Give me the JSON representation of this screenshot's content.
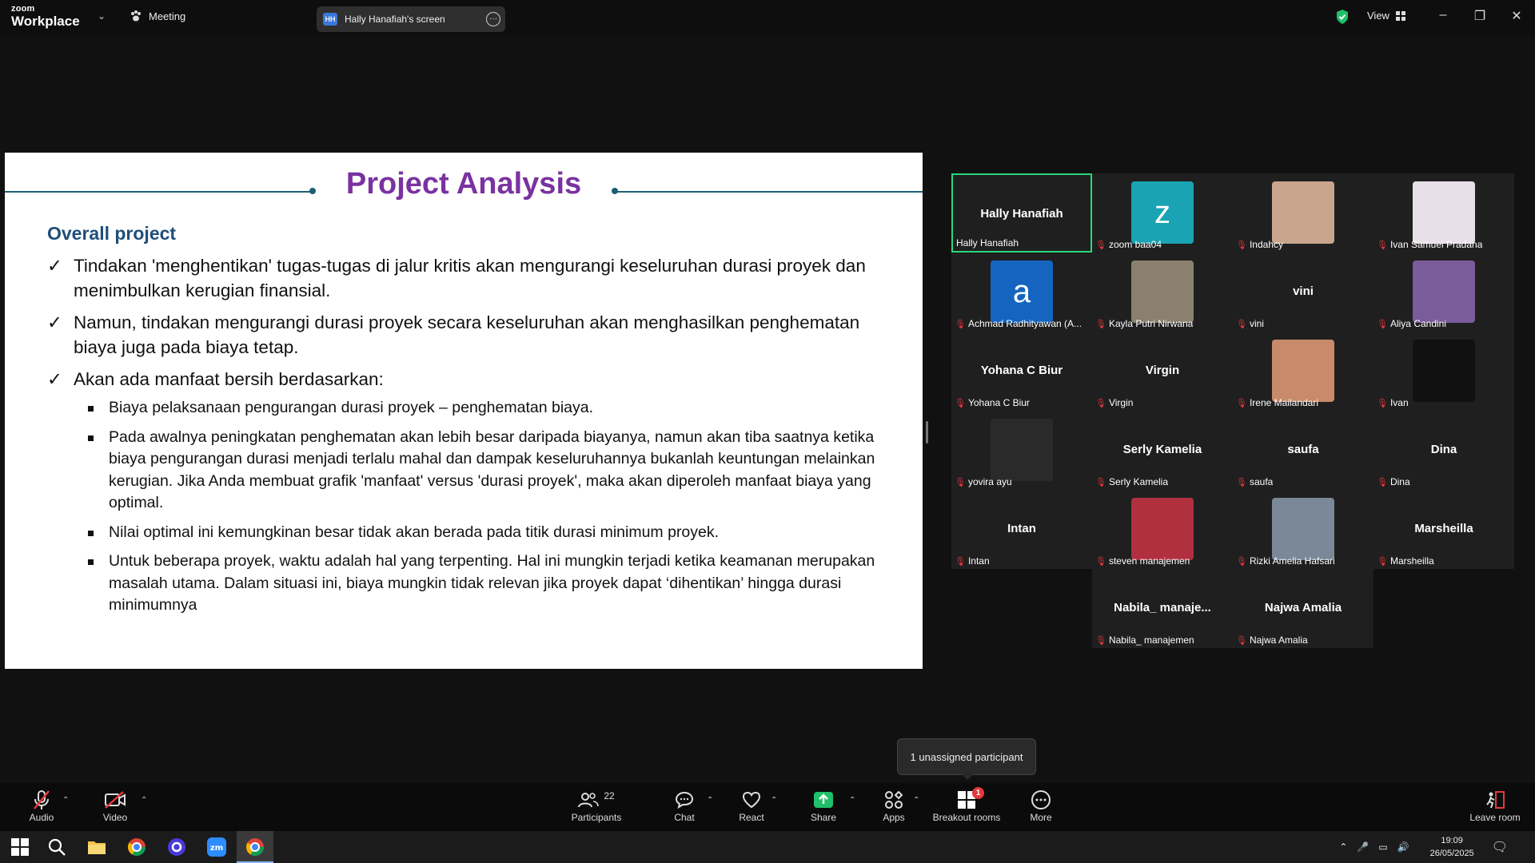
{
  "app": {
    "logo_line1": "zoom",
    "logo_line2": "Workplace",
    "meeting_label": "Meeting",
    "screen_tab_initials": "HH",
    "screen_tab_label": "Hally Hanafiah's screen",
    "view_label": "View"
  },
  "slide": {
    "title": "Project Analysis",
    "subtitle": "Overall project",
    "bullets": [
      "Tindakan 'menghentikan' tugas-tugas di jalur kritis akan mengurangi keseluruhan durasi proyek dan menimbulkan kerugian finansial.",
      "Namun, tindakan mengurangi durasi proyek secara keseluruhan akan menghasilkan penghematan biaya juga pada biaya tetap.",
      "Akan ada manfaat bersih berdasarkan:"
    ],
    "sub_bullets": [
      "Biaya pelaksanaan pengurangan durasi proyek – penghematan biaya.",
      "Pada awalnya peningkatan penghematan akan lebih besar daripada biayanya, namun akan tiba saatnya ketika biaya pengurangan durasi menjadi terlalu mahal dan dampak keseluruhannya bukanlah keuntungan melainkan kerugian. Jika Anda membuat grafik 'manfaat' versus 'durasi proyek', maka akan diperoleh manfaat biaya yang optimal.",
      "Nilai optimal ini kemungkinan besar tidak akan berada pada titik durasi minimum proyek.",
      "Untuk beberapa proyek, waktu adalah hal yang terpenting. Hal ini mungkin terjadi ketika keamanan merupakan masalah utama. Dalam situasi ini, biaya mungkin tidak relevan jika proyek dapat ‘dihentikan’ hingga durasi minimumnya"
    ]
  },
  "participants": [
    {
      "name": "Hally Hanafiah",
      "label": "Hally Hanafiah",
      "tile_text": "Hally Hanafiah",
      "muted": false,
      "active": true
    },
    {
      "name": "zoom baa04",
      "label": "zoom baa04",
      "avatar_letter": "z",
      "avatar_color": "#1aa3b3",
      "muted": true
    },
    {
      "name": "Indahcy",
      "label": "Indahcy",
      "photo": true,
      "muted": true
    },
    {
      "name": "Ivan Samuel Pradana",
      "label": "Ivan Samuel Pradana",
      "photo": true,
      "muted": true
    },
    {
      "name": "Achmad Radhityawan",
      "label": "Achmad Radhityawan (A...",
      "avatar_letter": "a",
      "avatar_color": "#1565c0",
      "muted": true
    },
    {
      "name": "Kayla Putri Nirwana",
      "label": "Kayla Putri Nirwana",
      "photo": true,
      "muted": true
    },
    {
      "name": "vini",
      "label": "vini",
      "tile_text": "vini",
      "muted": true
    },
    {
      "name": "Aliya Candini",
      "label": "Aliya Candini",
      "photo": true,
      "muted": true
    },
    {
      "name": "Yohana C Biur",
      "label": "Yohana C Biur",
      "tile_text": "Yohana C Biur",
      "muted": true
    },
    {
      "name": "Virgin",
      "label": "Virgin",
      "tile_text": "Virgin",
      "muted": true
    },
    {
      "name": "Irene Mailandari",
      "label": "Irene Mailandari",
      "photo": true,
      "muted": true
    },
    {
      "name": "Ivan",
      "label": "Ivan",
      "photo": true,
      "muted": true
    },
    {
      "name": "yovira ayu",
      "label": "yovira ayu",
      "photo": true,
      "muted": true
    },
    {
      "name": "Serly Kamelia",
      "label": "Serly Kamelia",
      "tile_text": "Serly Kamelia",
      "muted": true
    },
    {
      "name": "saufa",
      "label": "saufa",
      "tile_text": "saufa",
      "muted": true
    },
    {
      "name": "Dina",
      "label": "Dina",
      "tile_text": "Dina",
      "muted": true
    },
    {
      "name": "Intan",
      "label": "Intan",
      "tile_text": "Intan",
      "muted": true
    },
    {
      "name": "steven manajemen",
      "label": "steven manajemen",
      "photo": true,
      "muted": true
    },
    {
      "name": "Rizki Amelia Hafsari",
      "label": "Rizki Amelia Hafsari",
      "photo": true,
      "muted": true
    },
    {
      "name": "Marsheilla",
      "label": "Marsheilla",
      "tile_text": "Marsheilla",
      "muted": true
    },
    {
      "name": "Nabila_ manajemen",
      "label": "Nabila_ manajemen",
      "tile_text": "Nabila_ manaje...",
      "muted": true
    },
    {
      "name": "Najwa Amalia",
      "label": "Najwa Amalia",
      "tile_text": "Najwa Amalia",
      "muted": true
    }
  ],
  "tooltip": "1 unassigned participant",
  "toolbar": {
    "audio": "Audio",
    "video": "Video",
    "participants": "Participants",
    "participants_count": "22",
    "chat": "Chat",
    "react": "React",
    "share": "Share",
    "apps": "Apps",
    "breakout": "Breakout rooms",
    "breakout_badge": "1",
    "more": "More",
    "leave": "Leave room"
  },
  "taskbar": {
    "time": "19:09",
    "date": "26/05/2025"
  },
  "colors": {
    "accent_green": "#2bd77a",
    "muted_red": "#e8383d",
    "slide_title": "#7a32a0",
    "slide_subtitle": "#1f4e79",
    "share_green": "#20c06a"
  }
}
